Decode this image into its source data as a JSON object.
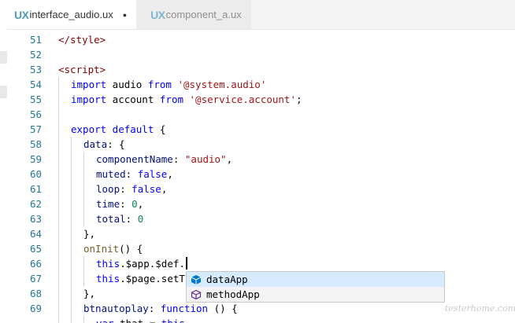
{
  "tabs": [
    {
      "badge": "UX",
      "label": "interface_audio.ux",
      "modified_dot": "●"
    },
    {
      "badge": "UX",
      "label": "component_a.ux"
    }
  ],
  "gutter": [
    "51",
    "52",
    "53",
    "54",
    "55",
    "56",
    "57",
    "58",
    "59",
    "60",
    "61",
    "62",
    "63",
    "64",
    "65",
    "66",
    "67",
    "68",
    "69"
  ],
  "code": {
    "l51": "</style>",
    "l53": "<script>",
    "l54": {
      "kw1": "import",
      "id": " audio ",
      "kw2": "from",
      "str": " '@system.audio'"
    },
    "l55": {
      "kw1": "import",
      "id": " account ",
      "kw2": "from",
      "str": " '@service.account'",
      "end": ";"
    },
    "l57": {
      "kw": "export default",
      "end": " {"
    },
    "l58": {
      "prop": "data",
      "end": ": {"
    },
    "l59": {
      "prop": "componentName",
      "sep": ": ",
      "str": "\"audio\"",
      "end": ","
    },
    "l60": {
      "prop": "muted",
      "sep": ": ",
      "val": "false",
      "end": ","
    },
    "l61": {
      "prop": "loop",
      "sep": ": ",
      "val": "false",
      "end": ","
    },
    "l62": {
      "prop": "time",
      "sep": ": ",
      "val": "0",
      "end": ","
    },
    "l63": {
      "prop": "total",
      "sep": ": ",
      "val": "0"
    },
    "l64": "},",
    "l65": {
      "fn": "onInit",
      "end": "() {"
    },
    "l66": {
      "kw": "this",
      "rest": ".$app.$def."
    },
    "l67": {
      "kw": "this",
      "rest": ".$page.setT"
    },
    "l68": "},",
    "l69": {
      "prop": "btnautoplay",
      "sep": ": ",
      "kw": "function",
      "end": " () {"
    },
    "l70": {
      "kw1": "var",
      "id": " that = ",
      "kw2": "this"
    }
  },
  "suggestions": [
    {
      "label": "dataApp",
      "icon": "field-icon",
      "selected": true
    },
    {
      "label": "methodApp",
      "icon": "method-icon",
      "selected": false
    }
  ],
  "watermark": "testerhome.com"
}
